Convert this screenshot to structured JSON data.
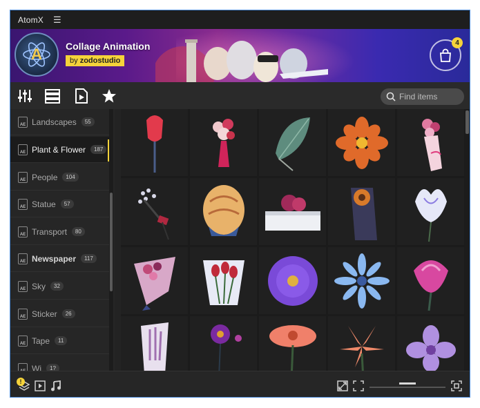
{
  "app": {
    "title": "AtomX",
    "menu_icon": "hamburger-icon"
  },
  "banner": {
    "title": "Collage Animation",
    "by_prefix": "by",
    "author": "zodostudio",
    "logo_letter": "A",
    "cart_count": "4"
  },
  "toolbar": {
    "icons": [
      "sliders-icon",
      "list-view-icon",
      "video-file-icon",
      "star-icon"
    ],
    "search_placeholder": "Find items"
  },
  "sidebar": {
    "categories": [
      {
        "label": "Landscapes",
        "count": "55"
      },
      {
        "label": "Plant & Flower",
        "count": "187",
        "active": true
      },
      {
        "label": "People",
        "count": "104"
      },
      {
        "label": "Statue",
        "count": "57"
      },
      {
        "label": "Transport",
        "count": "80"
      },
      {
        "label": "Newspaper",
        "count": "117"
      },
      {
        "label": "Sky",
        "count": "32"
      },
      {
        "label": "Sticker",
        "count": "26"
      },
      {
        "label": "Tape",
        "count": "11"
      },
      {
        "label": "Wi",
        "count": "1?"
      }
    ]
  },
  "grid": {
    "items": [
      "red-tulip",
      "pink-rose-bouquet",
      "green-leaf",
      "orange-cosmos",
      "pink-wrapped-bouquet",
      "dark-flower-sprig",
      "yellow-rose",
      "pink-flowers-in-box",
      "sunflower-on-fabric",
      "white-lily-flower",
      "pink-paper-bouquet",
      "tulip-bouquet",
      "purple-aster",
      "blue-daisy",
      "pink-lotus",
      "lavender-in-wrap",
      "purple-pansy",
      "salmon-gerbera",
      "orange-lily",
      "purple-orchid"
    ]
  },
  "statusbar": {
    "warning": "!",
    "left_icons": [
      "layers-icon",
      "play-box-icon",
      "music-note-icon"
    ],
    "right_icons": [
      "expand-icon",
      "fit-screen-icon",
      "fullscreen-icon"
    ],
    "zoom_level": 0.5
  },
  "colors": {
    "accent": "#f5d33a",
    "window_border": "#4a8ad8",
    "background": "#232323"
  }
}
